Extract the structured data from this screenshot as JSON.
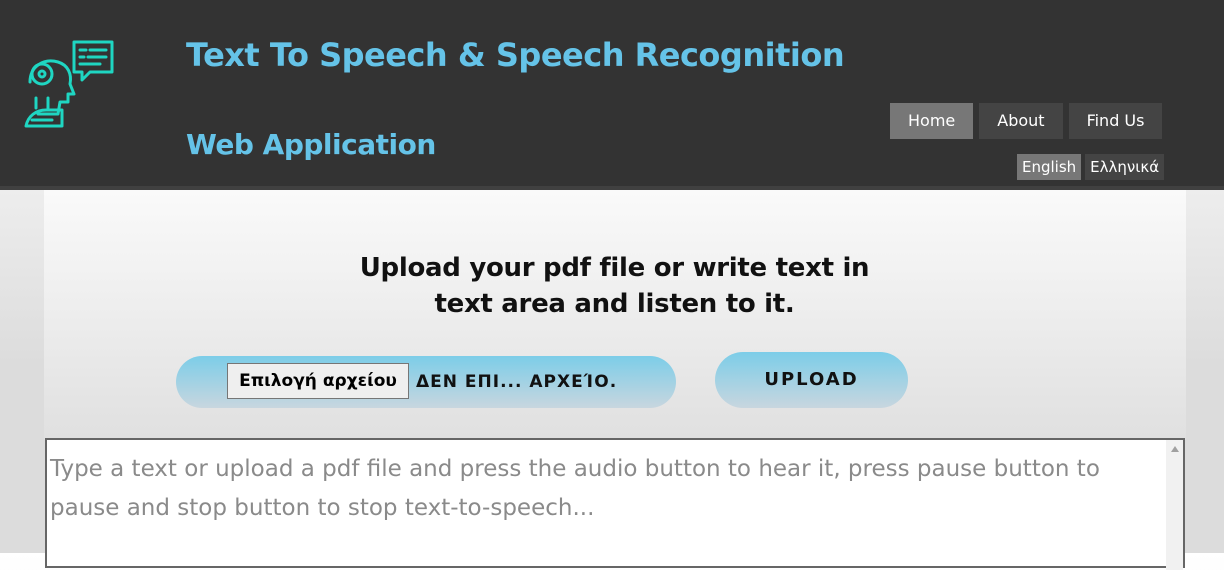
{
  "header": {
    "title_line1": "Text To Speech & Speech Recognition",
    "title_line2": "Web Application",
    "logo_icon": "robot-head-with-speech-bubble-icon"
  },
  "nav": {
    "items": [
      {
        "label": "Home",
        "active": true
      },
      {
        "label": "About",
        "active": false
      },
      {
        "label": "Find Us",
        "active": false
      }
    ]
  },
  "language": {
    "options": [
      {
        "label": "English",
        "active": true
      },
      {
        "label": "Ελληνικά",
        "active": false
      }
    ]
  },
  "main": {
    "heading_line1": "Upload your pdf file or write text in",
    "heading_line2": "text area and listen to it.",
    "file_button_label": "Επιλογή αρχείου",
    "file_status": "ΔΕΝ ΕΠΙ... ΑΡΧΕΊΟ.",
    "upload_label": "UPLOAD",
    "textarea_placeholder": "Type a text or upload a pdf file and press the audio button to hear it, press pause button to pause and stop button to stop text-to-speech..."
  },
  "colors": {
    "header_bg": "#333333",
    "title": "#65c3e8",
    "nav_active": "#777777",
    "nav_bg": "#444444",
    "logo": "#1fd6c2",
    "button_gradient_top": "#7ccde8",
    "button_gradient_bottom": "#c8d6df"
  }
}
